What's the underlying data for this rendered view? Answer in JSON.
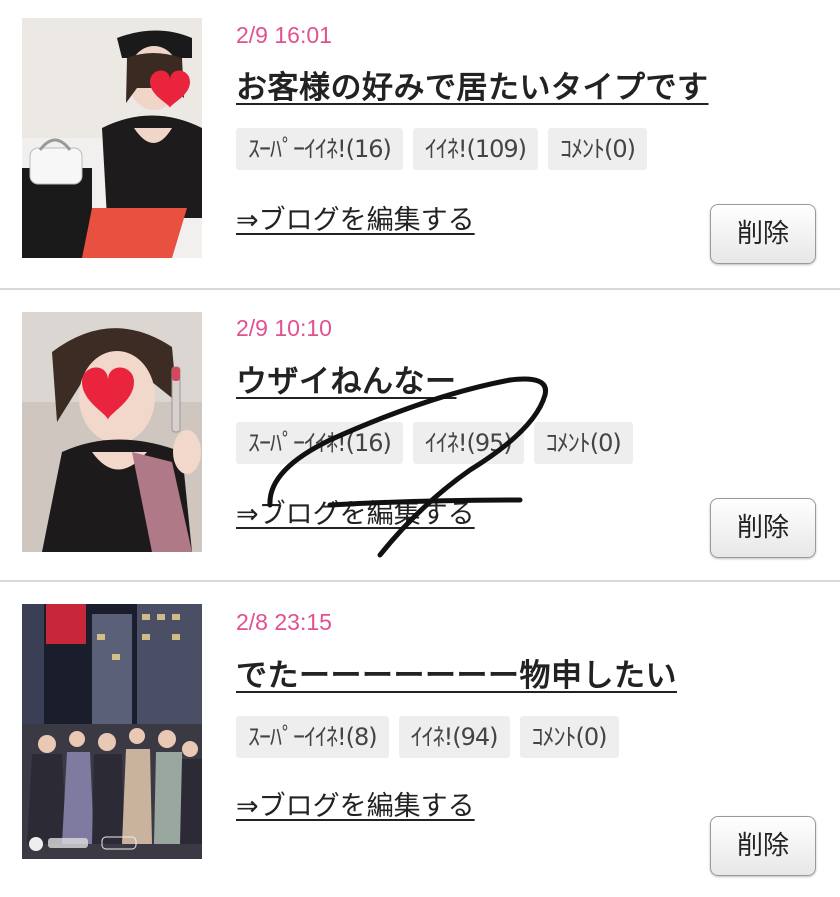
{
  "posts": [
    {
      "date": "2/9 16:01",
      "title": "お客様の好みで居たいタイプです",
      "super_like": "ｽｰﾊﾟｰｲｲﾈ!(16)",
      "like": "ｲｲﾈ!(109)",
      "comment": "ｺﾒﾝﾄ(0)",
      "edit_link": "⇒ブログを編集する",
      "delete_label": "削除"
    },
    {
      "date": "2/9 10:10",
      "title": "ウザイねんなー",
      "super_like": "ｽｰﾊﾟｰｲｲﾈ!(16)",
      "like": "ｲｲﾈ!(95)",
      "comment": "ｺﾒﾝﾄ(0)",
      "edit_link": "⇒ブログを編集する",
      "delete_label": "削除"
    },
    {
      "date": "2/8 23:15",
      "title": "でたーーーーーーー物申したい",
      "super_like": "ｽｰﾊﾟｰｲｲﾈ!(8)",
      "like": "ｲｲﾈ!(94)",
      "comment": "ｺﾒﾝﾄ(0)",
      "edit_link": "⇒ブログを編集する",
      "delete_label": "削除"
    }
  ],
  "colors": {
    "date": "#e0528f",
    "tag_bg": "#eeeeee",
    "divider": "#d9d9d9"
  },
  "icons": [
    "heart-sticker-icon"
  ]
}
